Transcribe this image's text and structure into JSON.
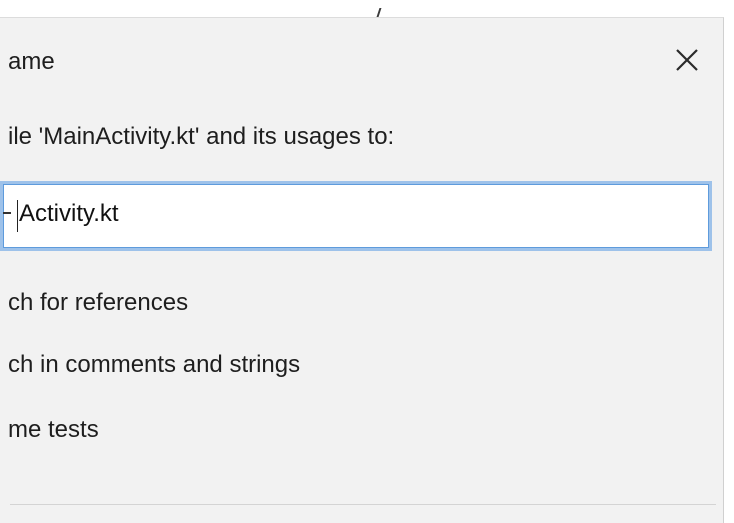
{
  "dialog": {
    "title": "ame",
    "close_icon": "close-icon",
    "prompt": "File 'MainActivity.kt' and its usages to:",
    "prompt_visible": "ile 'MainActivity.kt' and its usages to:",
    "name_input": {
      "value": "Activity.kt"
    },
    "options": [
      {
        "label": "ch for references"
      },
      {
        "label": "ch in comments and strings"
      },
      {
        "label": "me tests"
      }
    ]
  }
}
